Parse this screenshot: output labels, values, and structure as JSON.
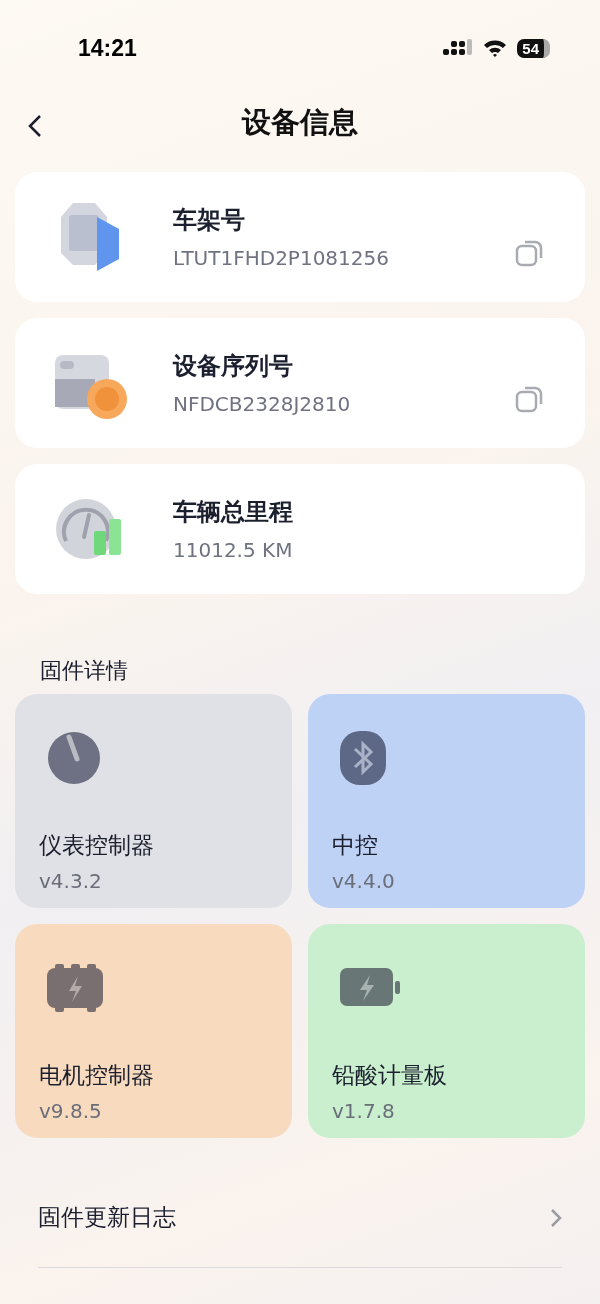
{
  "status_bar": {
    "time": "14:21",
    "battery": "54"
  },
  "nav": {
    "title": "设备信息"
  },
  "info_cards": [
    {
      "kind": "vin",
      "title": "车架号",
      "value": "LTUT1FHD2P1081256",
      "copyable": true
    },
    {
      "kind": "serial",
      "title": "设备序列号",
      "value": "NFDCB2328J2810",
      "copyable": true
    },
    {
      "kind": "odometer",
      "title": "车辆总里程",
      "value": "11012.5 KM",
      "copyable": false
    }
  ],
  "firmware": {
    "title": "固件详情",
    "tiles": [
      {
        "kind": "gauge",
        "name": "仪表控制器",
        "version": "v4.3.2",
        "color": "#e0e1e6"
      },
      {
        "kind": "bluetooth",
        "name": "中控",
        "version": "v4.4.0",
        "color": "#bed2f6"
      },
      {
        "kind": "motor",
        "name": "电机控制器",
        "version": "v9.8.5",
        "color": "#f8dbbf"
      },
      {
        "kind": "battery",
        "name": "铅酸计量板",
        "version": "v1.7.8",
        "color": "#c9efce"
      }
    ]
  },
  "links": [
    {
      "label": "固件更新日志"
    }
  ]
}
